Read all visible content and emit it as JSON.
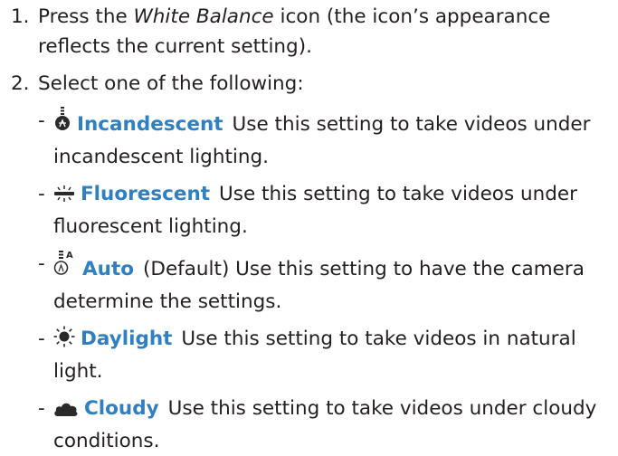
{
  "steps": [
    {
      "number": "1.",
      "text_before": "Press the ",
      "emphasis": "White Balance",
      "text_after": " icon (the icon’s appearance reflects the current setting)."
    },
    {
      "number": "2.",
      "text": "Select one of the following:"
    }
  ],
  "options": [
    {
      "dash": "-",
      "icon": "incandescent-bulb-icon",
      "name": "Incandescent",
      "description": "Use this setting to take videos under incandescent lighting."
    },
    {
      "dash": "-",
      "icon": "fluorescent-tube-icon",
      "name": "Fluorescent",
      "description": "Use this setting to take videos under fluorescent lighting."
    },
    {
      "dash": "-",
      "icon": "auto-bulb-icon",
      "icon_letter": "A",
      "name": "Auto",
      "description": "(Default) Use this setting to have the camera determine the settings."
    },
    {
      "dash": "-",
      "icon": "daylight-sun-icon",
      "name": "Daylight",
      "description": "Use this setting to take videos in natural light."
    },
    {
      "dash": "-",
      "icon": "cloud-icon",
      "name": "Cloudy",
      "description": "Use this setting to take videos under cloudy conditions."
    }
  ],
  "colors": {
    "text": "#231f20",
    "accent": "#2f7fc1",
    "icon": "#2a2a2a"
  }
}
